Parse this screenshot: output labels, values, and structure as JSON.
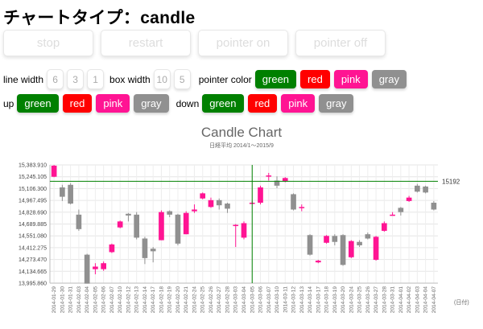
{
  "page": {
    "title": "チャートタイプ：candle"
  },
  "controls": {
    "big_buttons": [
      "stop",
      "restart",
      "pointer on",
      "pointer off"
    ],
    "line_width_label": "line width",
    "line_width_options": [
      "6",
      "3",
      "1"
    ],
    "box_width_label": "box width",
    "box_width_options": [
      "10",
      "5"
    ],
    "pointer_color_label": "pointer color",
    "up_label": "up",
    "down_label": "down",
    "colors": [
      {
        "label": "green",
        "color": "#008000"
      },
      {
        "label": "red",
        "color": "#ff0000"
      },
      {
        "label": "pink",
        "color": "#ff1493"
      },
      {
        "label": "gray",
        "color": "#909090"
      }
    ]
  },
  "chart_data": {
    "type": "candlestick",
    "title": "Candle Chart",
    "subtitle": "日経平均 2014/1～2015/9",
    "xlabel": "(日付)",
    "ylim": [
      13995.86,
      15383.91
    ],
    "y_ticks": [
      "15,383.910",
      "15,245.105",
      "15,106.300",
      "14,967.495",
      "14,828.690",
      "14,689.885",
      "14,551.080",
      "14,412.275",
      "14,273.470",
      "14,134.665",
      "13,995.860"
    ],
    "pointer_value": "15192",
    "pointer_date_index": 24,
    "up_color": "#ff1493",
    "down_color": "#909090",
    "pointer_color": "#008000",
    "grid": true,
    "candles": [
      {
        "date": "2014-01-29",
        "open": 15245,
        "close": 15375,
        "high": 15383,
        "low": 15240
      },
      {
        "date": "2014-01-30",
        "open": 15120,
        "close": 15010,
        "high": 15150,
        "low": 14960
      },
      {
        "date": "2014-01-31",
        "open": 15150,
        "close": 14930,
        "high": 15170,
        "low": 14920
      },
      {
        "date": "2014-02-03",
        "open": 14800,
        "close": 14630,
        "high": 14860,
        "low": 14610
      },
      {
        "date": "2014-02-04",
        "open": 14330,
        "close": 13990,
        "high": 14340,
        "low": 13990
      },
      {
        "date": "2014-02-05",
        "open": 14160,
        "close": 14190,
        "high": 14230,
        "low": 14100
      },
      {
        "date": "2014-02-06",
        "open": 14160,
        "close": 14230,
        "high": 14250,
        "low": 14140
      },
      {
        "date": "2014-02-07",
        "open": 14360,
        "close": 14450,
        "high": 14460,
        "low": 14350
      },
      {
        "date": "2014-02-10",
        "open": 14650,
        "close": 14720,
        "high": 14730,
        "low": 14640
      },
      {
        "date": "2014-02-12",
        "open": 14810,
        "close": 14790,
        "high": 14820,
        "low": 14720
      },
      {
        "date": "2014-02-13",
        "open": 14800,
        "close": 14530,
        "high": 14830,
        "low": 14510
      },
      {
        "date": "2014-02-14",
        "open": 14520,
        "close": 14290,
        "high": 14540,
        "low": 14220
      },
      {
        "date": "2014-02-17",
        "open": 14400,
        "close": 14370,
        "high": 14420,
        "low": 14240
      },
      {
        "date": "2014-02-18",
        "open": 14500,
        "close": 14830,
        "high": 14850,
        "low": 14500
      },
      {
        "date": "2014-02-19",
        "open": 14840,
        "close": 14800,
        "high": 14850,
        "low": 14770
      },
      {
        "date": "2014-02-20",
        "open": 14800,
        "close": 14460,
        "high": 14810,
        "low": 14440
      },
      {
        "date": "2014-02-21",
        "open": 14570,
        "close": 14820,
        "high": 14840,
        "low": 14570
      },
      {
        "date": "2014-02-24",
        "open": 14840,
        "close": 14860,
        "high": 14920,
        "low": 14820
      },
      {
        "date": "2014-02-25",
        "open": 14990,
        "close": 15050,
        "high": 15060,
        "low": 14980
      },
      {
        "date": "2014-02-26",
        "open": 14890,
        "close": 14970,
        "high": 15000,
        "low": 14880
      },
      {
        "date": "2014-02-27",
        "open": 14970,
        "close": 14910,
        "high": 14990,
        "low": 14860
      },
      {
        "date": "2014-02-28",
        "open": 14930,
        "close": 14870,
        "high": 14940,
        "low": 14820
      },
      {
        "date": "2014-03-03",
        "open": 14680,
        "close": 14680,
        "high": 14690,
        "low": 14420
      },
      {
        "date": "2014-03-04",
        "open": 14530,
        "close": 14700,
        "high": 14720,
        "low": 14510
      },
      {
        "date": "2014-03-05",
        "open": 14940,
        "close": 14940,
        "high": 14960,
        "low": 14940
      },
      {
        "date": "2014-03-06",
        "open": 14940,
        "close": 15120,
        "high": 15140,
        "low": 14920
      },
      {
        "date": "2014-03-07",
        "open": 15250,
        "close": 15260,
        "high": 15290,
        "low": 15200
      },
      {
        "date": "2014-03-10",
        "open": 15200,
        "close": 15140,
        "high": 15250,
        "low": 15110
      },
      {
        "date": "2014-03-11",
        "open": 15190,
        "close": 15230,
        "high": 15240,
        "low": 15180
      },
      {
        "date": "2014-03-12",
        "open": 15040,
        "close": 14860,
        "high": 15050,
        "low": 14850
      },
      {
        "date": "2014-03-13",
        "open": 14880,
        "close": 14890,
        "high": 14920,
        "low": 14840
      },
      {
        "date": "2014-03-14",
        "open": 14560,
        "close": 14330,
        "high": 14570,
        "low": 14320
      },
      {
        "date": "2014-03-17",
        "open": 14240,
        "close": 14260,
        "high": 14270,
        "low": 14230
      },
      {
        "date": "2014-03-18",
        "open": 14470,
        "close": 14550,
        "high": 14560,
        "low": 14460
      },
      {
        "date": "2014-03-19",
        "open": 14550,
        "close": 14480,
        "high": 14570,
        "low": 14440
      },
      {
        "date": "2014-03-20",
        "open": 14560,
        "close": 14210,
        "high": 14570,
        "low": 14200
      },
      {
        "date": "2014-03-24",
        "open": 14300,
        "close": 14490,
        "high": 14500,
        "low": 14290
      },
      {
        "date": "2014-03-25",
        "open": 14480,
        "close": 14440,
        "high": 14500,
        "low": 14420
      },
      {
        "date": "2014-03-26",
        "open": 14570,
        "close": 14520,
        "high": 14590,
        "low": 14510
      },
      {
        "date": "2014-03-27",
        "open": 14270,
        "close": 14540,
        "high": 14550,
        "low": 14260
      },
      {
        "date": "2014-03-28",
        "open": 14610,
        "close": 14700,
        "high": 14720,
        "low": 14600
      },
      {
        "date": "2014-03-31",
        "open": 14800,
        "close": 14800,
        "high": 14830,
        "low": 14790
      },
      {
        "date": "2014-04-01",
        "open": 14880,
        "close": 14830,
        "high": 14890,
        "low": 14790
      },
      {
        "date": "2014-04-02",
        "open": 14960,
        "close": 15000,
        "high": 15020,
        "low": 14950
      },
      {
        "date": "2014-04-03",
        "open": 15140,
        "close": 15070,
        "high": 15160,
        "low": 15060
      },
      {
        "date": "2014-04-04",
        "open": 15130,
        "close": 15060,
        "high": 15140,
        "low": 15050
      },
      {
        "date": "2014-04-07",
        "open": 14940,
        "close": 14860,
        "high": 14960,
        "low": 14850
      }
    ]
  }
}
